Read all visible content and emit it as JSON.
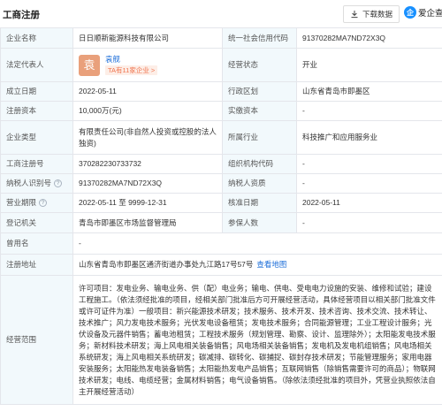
{
  "header": {
    "title": "工商注册",
    "download_label": "下载数据",
    "brand_logo_text": "企",
    "brand_name": "爱企查"
  },
  "colors": {
    "label_bg": "#f2f9fc",
    "border": "#e4e6eb",
    "link": "#1e6fd9",
    "badge_text": "#f0734d",
    "avatar_bg": "#e9a07b"
  },
  "rows": {
    "company_name": {
      "label": "企业名称",
      "value": "日日顺新能源科技有限公司"
    },
    "credit_code": {
      "label": "统一社会信用代码",
      "value": "91370282MA7ND72X3Q"
    },
    "legal_rep": {
      "label": "法定代表人",
      "avatar_char": "袁",
      "name": "袁舰",
      "badge": "TA有11家企业 >"
    },
    "status": {
      "label": "经营状态",
      "value": "开业"
    },
    "founded": {
      "label": "成立日期",
      "value": "2022-05-11"
    },
    "region": {
      "label": "行政区划",
      "value": "山东省青岛市即墨区"
    },
    "capital": {
      "label": "注册资本",
      "value": "10,000万(元)"
    },
    "paid_capital": {
      "label": "实缴资本",
      "value": "-"
    },
    "company_type": {
      "label": "企业类型",
      "value": "有限责任公司(非自然人投资或控股的法人独资)"
    },
    "industry": {
      "label": "所属行业",
      "value": "科技推广和应用服务业"
    },
    "reg_no": {
      "label": "工商注册号",
      "value": "370282230733732"
    },
    "org_code": {
      "label": "组织机构代码",
      "value": "-"
    },
    "taxpayer_id": {
      "label": "纳税人识别号",
      "value": "91370282MA7ND72X3Q"
    },
    "taxpayer_qual": {
      "label": "纳税人资质",
      "value": "-"
    },
    "term": {
      "label": "营业期限",
      "value": "2022-05-11 至 9999-12-31"
    },
    "approval_date": {
      "label": "核准日期",
      "value": "2022-05-11"
    },
    "authority": {
      "label": "登记机关",
      "value": "青岛市即墨区市场监督管理局"
    },
    "insured": {
      "label": "参保人数",
      "value": "-"
    },
    "former_name": {
      "label": "曾用名",
      "value": "-"
    },
    "address": {
      "label": "注册地址",
      "value": "山东省青岛市即墨区通济街道办事处九江路17号57号",
      "map_link": "查看地图"
    },
    "scope": {
      "label": "经营范围",
      "value": "许可项目：发电业务、输电业务、供（配）电业务；输电、供电、受电电力设施的安装、维修和试验；建设工程施工。（依法须经批准的项目，经相关部门批准后方可开展经营活动，具体经营项目以相关部门批准文件或许可证件为准）一般项目：新兴能源技术研发；技术服务、技术开发、技术咨询、技术交流、技术转让、技术推广；风力发电技术服务；光伏发电设备租赁；发电技术服务；合同能源管理；工业工程设计服务；光伏设备及元器件销售；蓄电池租赁；工程技术服务（规划管理、勘察、设计、监理除外）；太阳能发电技术服务；新材料技术研发；海上风电相关装备销售；风电场相关装备销售；发电机及发电机组销售；风电场相关系统研发；海上风电相关系统研发；碳减排、碳转化、碳捕捉、碳封存技术研发；节能管理服务；家用电器安装服务；太阳能热发电装备销售；太阳能热发电产品销售；互联网销售（除销售需要许可的商品）；物联网技术研发；电线、电缆经营；金属材料销售；电气设备销售。（除依法须经批准的项目外，凭营业执照依法自主开展经营活动）"
    }
  }
}
